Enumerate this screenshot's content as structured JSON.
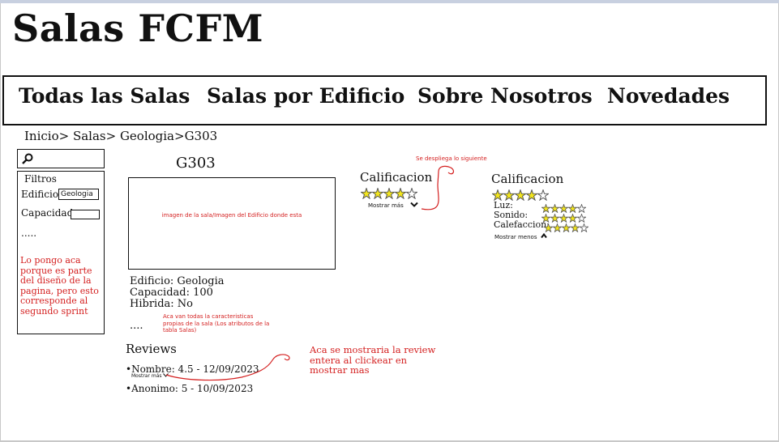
{
  "site": {
    "title": "Salas FCFM"
  },
  "nav": {
    "items": [
      "Todas las Salas",
      "Salas por Edificio",
      "Sobre Nosotros",
      "Novedades"
    ]
  },
  "breadcrumb": "Inicio> Salas> Geologia>G303",
  "filters": {
    "title": "Filtros",
    "edificio_label": "Edificio:",
    "edificio_value": "Geologia",
    "capacidad_label": "Capacidad:",
    "capacidad_value": "",
    "dots": ".....",
    "note": "Lo pongo aca porque es parte del diseño de la pagina, pero esto corresponde al segundo sprint"
  },
  "room": {
    "title": "G303",
    "image_caption": "imagen de la sala/Imagen del Edificio donde esta",
    "attributes": [
      "Edificio: Geologia",
      "Capacidad: 100",
      "Hibrida: No"
    ],
    "dots": "....",
    "note": "Aca van todas la caracteristicas propias de la sala (Los atributos de la tabla Salas)"
  },
  "rating_collapsed": {
    "title": "Calificacion",
    "stars": 4,
    "max": 5,
    "toggle_label": "Mostrar más"
  },
  "rating_expanded": {
    "title": "Calificacion",
    "stars": 4,
    "max": 5,
    "categories": [
      {
        "label": "Luz:",
        "stars": 4
      },
      {
        "label": "Sonido:",
        "stars": 4
      },
      {
        "label": "Calefaccion:",
        "stars": 4
      }
    ],
    "toggle_label": "Mostrar menos"
  },
  "annotations": {
    "deploy_note": "Se despliega lo siguiente",
    "review_note": "Aca se mostraria la review entera al clickear en mostrar mas"
  },
  "reviews": {
    "title": "Reviews",
    "items": [
      {
        "text": "•Nombre: 4.5 - 12/09/2023",
        "toggle_label": "Mostrar más"
      },
      {
        "text": "•Anonimo: 5 - 10/09/2023"
      }
    ]
  },
  "colors": {
    "annotation": "#d42020",
    "star_fill": "#f2e51c",
    "star_outline": "#555555"
  },
  "icons": {
    "search": "search-icon",
    "chevron_down": "chevron-down-icon",
    "chevron_up": "chevron-up-icon",
    "star": "star-icon"
  }
}
